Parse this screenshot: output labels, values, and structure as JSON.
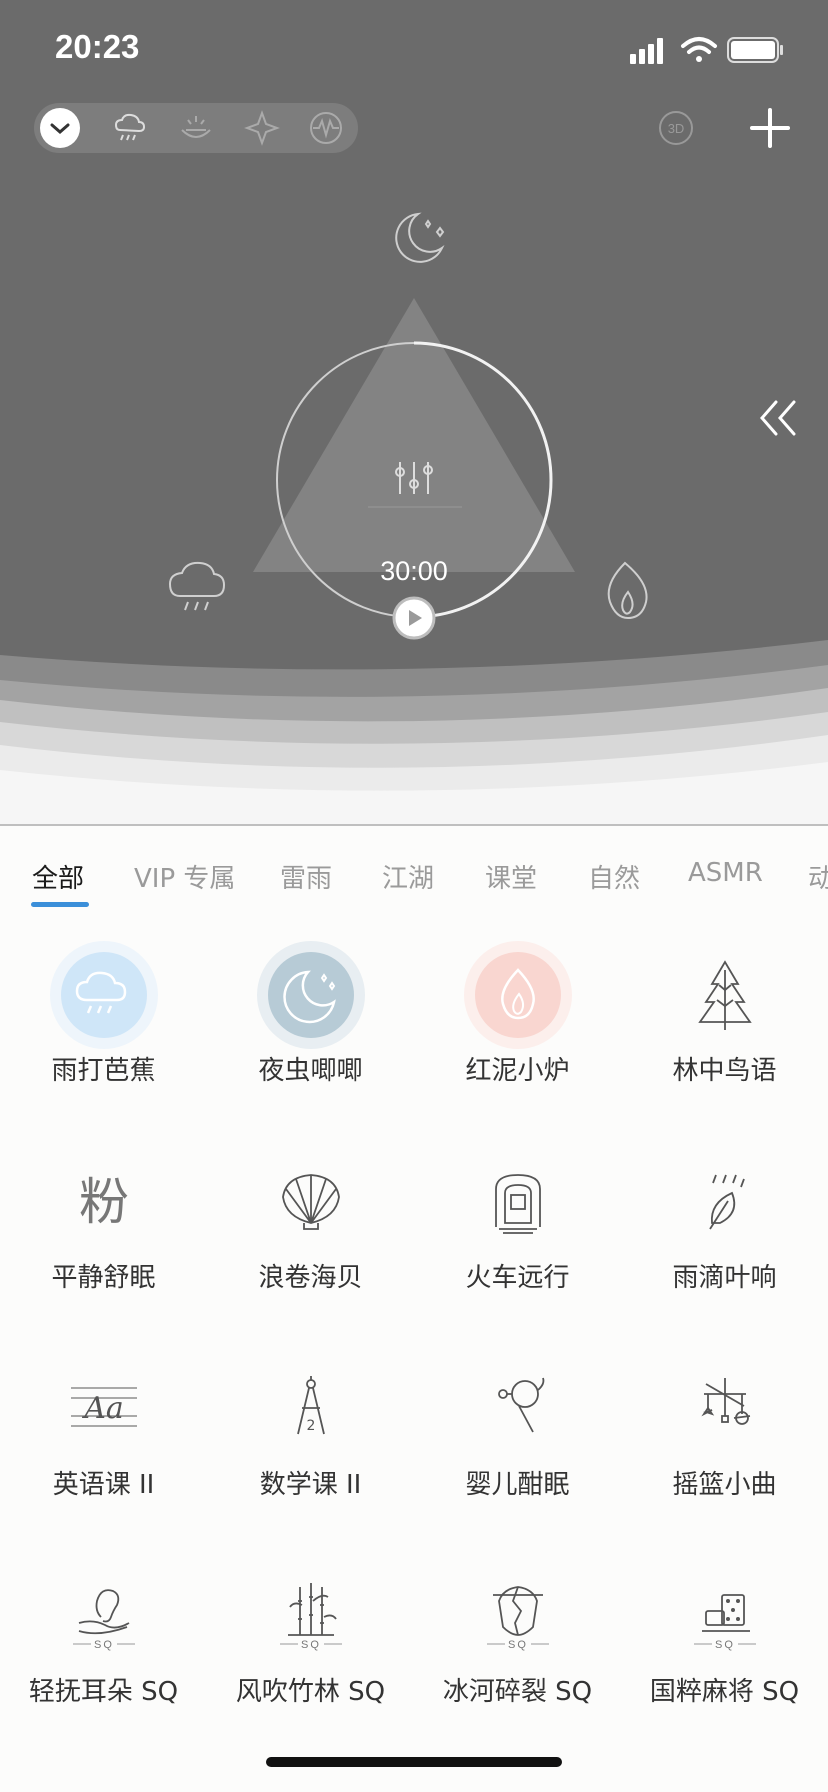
{
  "status": {
    "time": "20:23"
  },
  "top_bar": {
    "pill_icons": [
      "chevron-down-icon",
      "rain-cloud-icon",
      "campfire-icon",
      "sparkle-icon",
      "soundwave-icon"
    ],
    "badge_3d": "3D",
    "add_icon": "plus-icon"
  },
  "player": {
    "timer": "30:00",
    "nodes": [
      "moon-stars-icon",
      "rain-cloud-icon",
      "flame-icon"
    ],
    "center_icon": "mixer-sliders-icon"
  },
  "tabs": [
    {
      "label": "全部",
      "active": true
    },
    {
      "label": "VIP 专属"
    },
    {
      "label": "雷雨"
    },
    {
      "label": "江湖"
    },
    {
      "label": "课堂"
    },
    {
      "label": "自然"
    },
    {
      "label": "ASMR"
    },
    {
      "label": "动"
    }
  ],
  "sounds": [
    {
      "label": "雨打芭蕉",
      "icon": "rain-cloud-icon",
      "color": "#cfe6f8",
      "selected": true
    },
    {
      "label": "夜虫唧唧",
      "icon": "moon-stars-icon",
      "color": "#b7cbd6",
      "selected": true
    },
    {
      "label": "红泥小炉",
      "icon": "flame-icon",
      "color": "#f9d6d0",
      "selected": true
    },
    {
      "label": "林中鸟语",
      "icon": "pine-tree-icon"
    },
    {
      "label": "平静舒眠",
      "icon": "fen-character-icon",
      "glyph": "粉"
    },
    {
      "label": "浪卷海贝",
      "icon": "seashell-icon"
    },
    {
      "label": "火车远行",
      "icon": "train-tunnel-icon"
    },
    {
      "label": "雨滴叶响",
      "icon": "rain-leaf-icon"
    },
    {
      "label": "英语课 II",
      "icon": "handwriting-aa-icon",
      "glyph": "Aa"
    },
    {
      "label": "数学课 II",
      "icon": "compass-icon",
      "glyph": "2"
    },
    {
      "label": "婴儿酣眠",
      "icon": "rattle-icon"
    },
    {
      "label": "摇篮小曲",
      "icon": "crib-mobile-icon"
    },
    {
      "label": "轻抚耳朵 SQ",
      "icon": "ear-hand-icon",
      "badge": "SQ"
    },
    {
      "label": "风吹竹林 SQ",
      "icon": "bamboo-icon",
      "badge": "SQ"
    },
    {
      "label": "冰河碎裂 SQ",
      "icon": "ice-crack-icon",
      "badge": "SQ"
    },
    {
      "label": "国粹麻将 SQ",
      "icon": "mahjong-icon",
      "badge": "SQ"
    }
  ],
  "colors": {
    "tab_indicator": "#3b8fd9",
    "top_background": "#6b6b6b"
  }
}
